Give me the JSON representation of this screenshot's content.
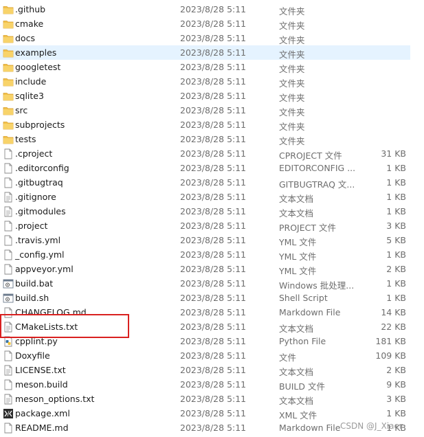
{
  "files": [
    {
      "name": ".github",
      "date": "2023/8/28 5:11",
      "type": "文件夹",
      "size": "",
      "icon": "folder-icon"
    },
    {
      "name": "cmake",
      "date": "2023/8/28 5:11",
      "type": "文件夹",
      "size": "",
      "icon": "folder-icon"
    },
    {
      "name": "docs",
      "date": "2023/8/28 5:11",
      "type": "文件夹",
      "size": "",
      "icon": "folder-icon"
    },
    {
      "name": "examples",
      "date": "2023/8/28 5:11",
      "type": "文件夹",
      "size": "",
      "icon": "folder-icon",
      "hover": true
    },
    {
      "name": "googletest",
      "date": "2023/8/28 5:11",
      "type": "文件夹",
      "size": "",
      "icon": "folder-icon"
    },
    {
      "name": "include",
      "date": "2023/8/28 5:11",
      "type": "文件夹",
      "size": "",
      "icon": "folder-icon"
    },
    {
      "name": "sqlite3",
      "date": "2023/8/28 5:11",
      "type": "文件夹",
      "size": "",
      "icon": "folder-icon"
    },
    {
      "name": "src",
      "date": "2023/8/28 5:11",
      "type": "文件夹",
      "size": "",
      "icon": "folder-icon"
    },
    {
      "name": "subprojects",
      "date": "2023/8/28 5:11",
      "type": "文件夹",
      "size": "",
      "icon": "folder-icon"
    },
    {
      "name": "tests",
      "date": "2023/8/28 5:11",
      "type": "文件夹",
      "size": "",
      "icon": "folder-icon"
    },
    {
      "name": ".cproject",
      "date": "2023/8/28 5:11",
      "type": "CPROJECT 文件",
      "size": "31 KB",
      "icon": "file-icon"
    },
    {
      "name": ".editorconfig",
      "date": "2023/8/28 5:11",
      "type": "EDITORCONFIG ...",
      "size": "1 KB",
      "icon": "file-icon"
    },
    {
      "name": ".gitbugtraq",
      "date": "2023/8/28 5:11",
      "type": "GITBUGTRAQ 文...",
      "size": "1 KB",
      "icon": "file-icon"
    },
    {
      "name": ".gitignore",
      "date": "2023/8/28 5:11",
      "type": "文本文档",
      "size": "1 KB",
      "icon": "text-file-icon"
    },
    {
      "name": ".gitmodules",
      "date": "2023/8/28 5:11",
      "type": "文本文档",
      "size": "1 KB",
      "icon": "text-file-icon"
    },
    {
      "name": ".project",
      "date": "2023/8/28 5:11",
      "type": "PROJECT 文件",
      "size": "3 KB",
      "icon": "file-icon"
    },
    {
      "name": ".travis.yml",
      "date": "2023/8/28 5:11",
      "type": "YML 文件",
      "size": "5 KB",
      "icon": "file-icon"
    },
    {
      "name": "_config.yml",
      "date": "2023/8/28 5:11",
      "type": "YML 文件",
      "size": "1 KB",
      "icon": "file-icon"
    },
    {
      "name": "appveyor.yml",
      "date": "2023/8/28 5:11",
      "type": "YML 文件",
      "size": "2 KB",
      "icon": "file-icon"
    },
    {
      "name": "build.bat",
      "date": "2023/8/28 5:11",
      "type": "Windows 批处理...",
      "size": "1 KB",
      "icon": "batch-file-icon"
    },
    {
      "name": "build.sh",
      "date": "2023/8/28 5:11",
      "type": "Shell Script",
      "size": "1 KB",
      "icon": "batch-file-icon"
    },
    {
      "name": "CHANGELOG.md",
      "date": "2023/8/28 5:11",
      "type": "Markdown File",
      "size": "14 KB",
      "icon": "file-icon"
    },
    {
      "name": "CMakeLists.txt",
      "date": "2023/8/28 5:11",
      "type": "文本文档",
      "size": "22 KB",
      "icon": "text-file-icon"
    },
    {
      "name": "cpplint.py",
      "date": "2023/8/28 5:11",
      "type": "Python File",
      "size": "181 KB",
      "icon": "python-file-icon"
    },
    {
      "name": "Doxyfile",
      "date": "2023/8/28 5:11",
      "type": "文件",
      "size": "109 KB",
      "icon": "file-icon"
    },
    {
      "name": "LICENSE.txt",
      "date": "2023/8/28 5:11",
      "type": "文本文档",
      "size": "2 KB",
      "icon": "text-file-icon"
    },
    {
      "name": "meson.build",
      "date": "2023/8/28 5:11",
      "type": "BUILD 文件",
      "size": "9 KB",
      "icon": "file-icon"
    },
    {
      "name": "meson_options.txt",
      "date": "2023/8/28 5:11",
      "type": "文本文档",
      "size": "3 KB",
      "icon": "text-file-icon"
    },
    {
      "name": "package.xml",
      "date": "2023/8/28 5:11",
      "type": "XML 文件",
      "size": "1 KB",
      "icon": "xml-file-icon"
    },
    {
      "name": "README.md",
      "date": "2023/8/28 5:11",
      "type": "Markdown File",
      "size": "1 KB",
      "icon": "file-icon"
    }
  ],
  "watermark": "CSDN @J_Xiaer",
  "colors": {
    "folder": "#f2c04a",
    "hover": "#e5f3ff",
    "highlight": "#d9201f"
  }
}
